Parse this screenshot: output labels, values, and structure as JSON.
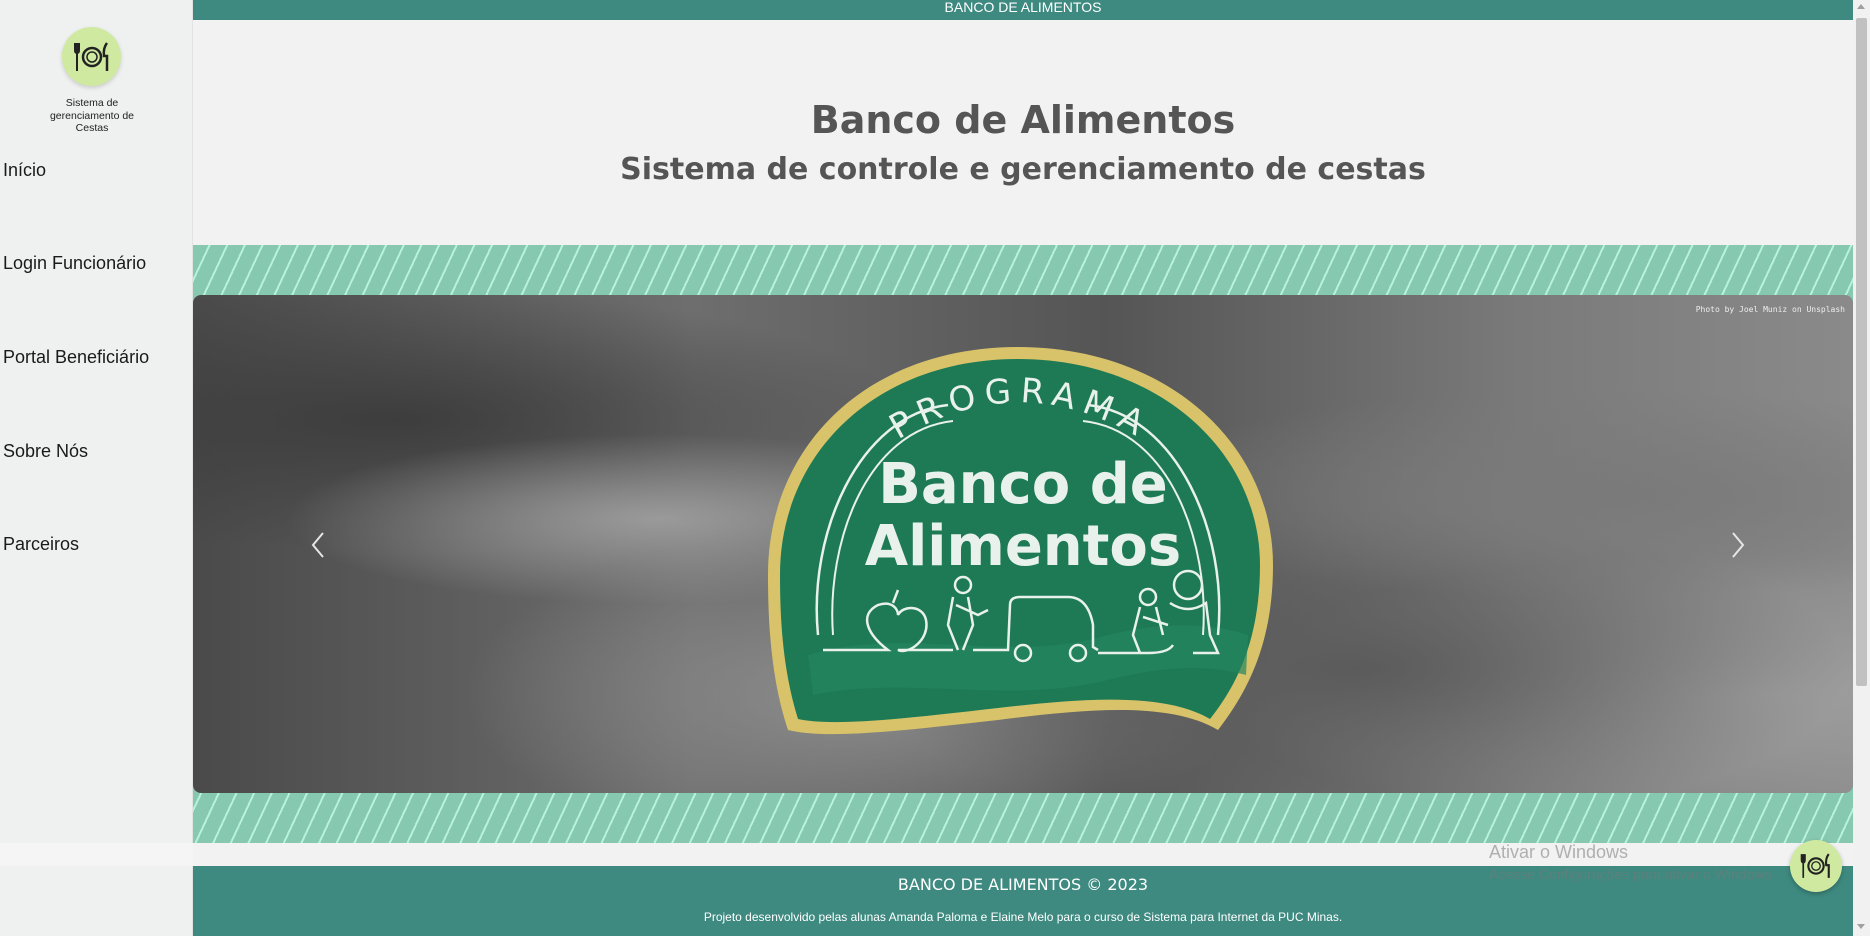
{
  "topbar": {
    "title": "BANCO DE ALIMENTOS"
  },
  "sidebar": {
    "logo_icon": "fork-plate-knife-icon",
    "tagline": "Sistema de gerenciamento de Cestas",
    "items": [
      {
        "label": "Início"
      },
      {
        "label": "Login Funcionário"
      },
      {
        "label": "Portal Beneficiário"
      },
      {
        "label": "Sobre Nós"
      },
      {
        "label": "Parceiros"
      }
    ]
  },
  "hero": {
    "title": "Banco de Alimentos",
    "subtitle": "Sistema de controle e gerenciamento de cestas"
  },
  "carousel": {
    "photo_credit": "Photo by Joel Muniz on Unsplash",
    "badge_top": "PROGRAMA",
    "badge_line1": "Banco de",
    "badge_line2": "Alimentos",
    "prev_icon": "chevron-left-icon",
    "next_icon": "chevron-right-icon"
  },
  "footer": {
    "title": "BANCO DE ALIMENTOS © 2023",
    "text": "Projeto desenvolvido pelas alunas Amanda Paloma e Elaine Melo para o curso de Sistema para Internet da PUC Minas."
  },
  "watermark": {
    "line1": "Ativar o Windows",
    "line2": "Acesse Configurações para ativar o Windows."
  },
  "colors": {
    "accent": "#3e8a80",
    "band": "#86c8b0",
    "logo_bg": "#cfeaa0",
    "badge_green": "#1e7a55",
    "badge_gold": "#d8c36a"
  }
}
